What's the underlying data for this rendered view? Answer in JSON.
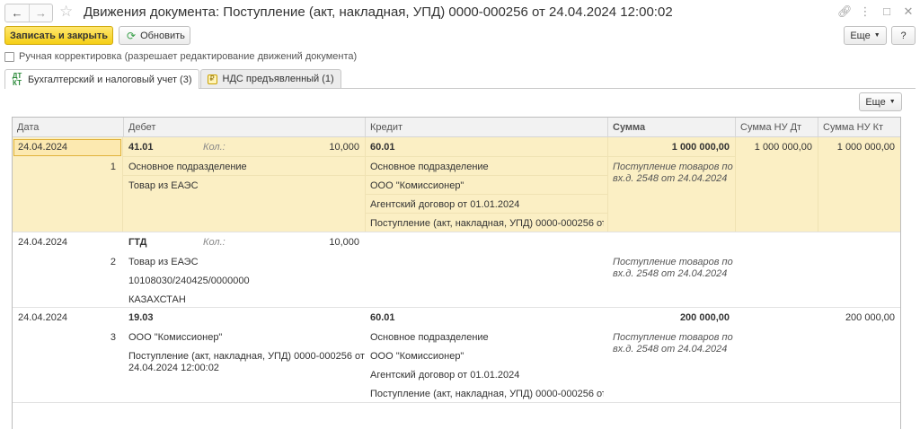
{
  "window": {
    "title": "Движения документа: Поступление (акт, накладная, УПД) 0000-000256 от 24.04.2024 12:00:02",
    "back_icon": "arrow-left-icon",
    "forward_icon": "arrow-right-icon",
    "star_icon": "star-icon"
  },
  "toolbar": {
    "save_close_label": "Записать и закрыть",
    "refresh_label": "Обновить",
    "more_label": "Еще",
    "help_label": "?"
  },
  "manual_correction_label": "Ручная корректировка (разрешает редактирование движений документа)",
  "tabs": [
    {
      "label": "Бухгалтерский и налоговый учет (3)",
      "icon": "dt-kt-icon",
      "icon_top": "ДТ",
      "icon_bottom": "КТ"
    },
    {
      "label": "НДС предъявленный (1)",
      "icon": "vat-icon",
      "icon_glyph": "₽"
    }
  ],
  "grid": {
    "more_label": "Еще",
    "columns": [
      "Дата",
      "Дебет",
      "Кредит",
      "Сумма",
      "Сумма НУ Дт",
      "Сумма НУ Кт"
    ],
    "qty_label": "Кол.:",
    "rows": [
      {
        "date": "24.04.2024",
        "num": "1",
        "debit_account": "41.01",
        "debit_qty": "10,000",
        "debit_subconto": [
          "Основное подразделение",
          "Товар из ЕАЭС"
        ],
        "credit_account": "60.01",
        "credit_subconto": [
          "Основное подразделение",
          "ООО \"Комиссионер\"",
          "Агентский договор от 01.01.2024",
          "Поступление (акт, накладная, УПД) 0000-000256 от..."
        ],
        "amount": "1 000 000,00",
        "content": [
          "Поступление товаров по",
          "вх.д. 2548 от 24.04.2024"
        ],
        "nu_dt": "1 000 000,00",
        "nu_kt": "1 000 000,00"
      },
      {
        "date": "24.04.2024",
        "num": "2",
        "debit_account": "ГТД",
        "debit_qty": "10,000",
        "debit_subconto": [
          "Товар из ЕАЭС",
          "10108030/240425/0000000",
          "КАЗАХСТАН"
        ],
        "credit_account": "",
        "credit_subconto": [],
        "amount": "",
        "content": [
          "Поступление товаров по",
          "вх.д. 2548 от 24.04.2024"
        ],
        "nu_dt": "",
        "nu_kt": ""
      },
      {
        "date": "24.04.2024",
        "num": "3",
        "debit_account": "19.03",
        "debit_qty": "",
        "debit_subconto": [
          "ООО \"Комиссионер\"",
          "Поступление (акт, накладная, УПД) 0000-000256 от",
          "24.04.2024 12:00:02"
        ],
        "credit_account": "60.01",
        "credit_subconto": [
          "Основное подразделение",
          "ООО \"Комиссионер\"",
          "Агентский договор от 01.01.2024",
          "Поступление (акт, накладная, УПД) 0000-000256 от..."
        ],
        "amount": "200 000,00",
        "content": [
          "Поступление товаров по",
          "вх.д. 2548 от 24.04.2024"
        ],
        "nu_dt": "",
        "nu_kt": "200 000,00"
      }
    ]
  },
  "colors": {
    "primary_button": "#f5cf16",
    "selected_row": "#fbefc4",
    "refresh_icon": "#3aa04a"
  }
}
